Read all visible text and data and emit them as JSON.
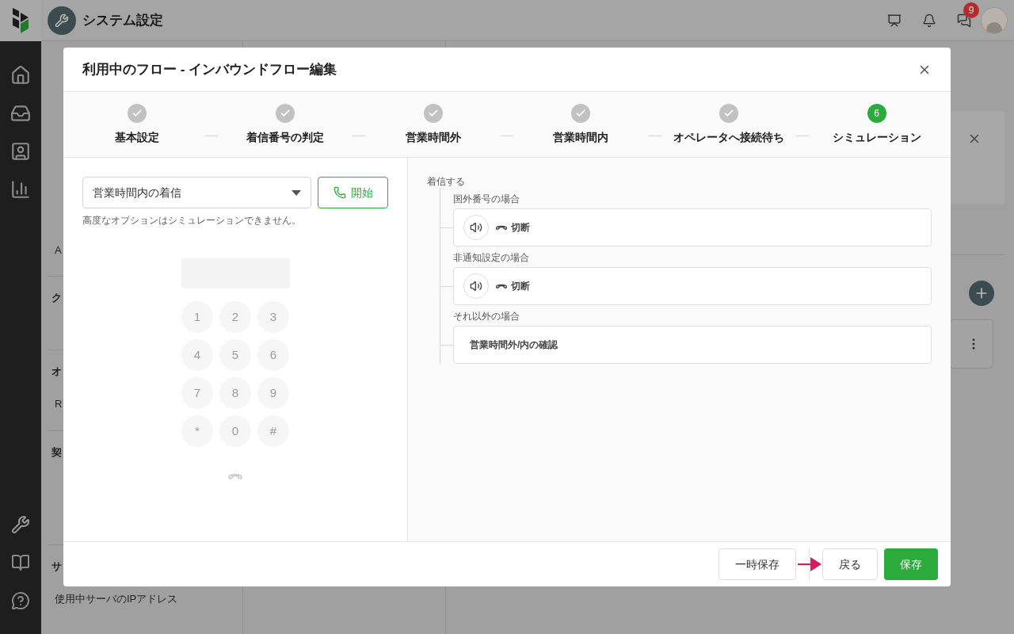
{
  "app_header": {
    "title": "システム設定",
    "notification_badge": "9"
  },
  "sidebar_fragments": [
    {
      "text": "A",
      "kind": "item",
      "selected": false
    },
    {
      "text": "ク",
      "kind": "heading",
      "selected": false
    },
    {
      "text": "オ",
      "kind": "heading",
      "selected": false
    },
    {
      "text": "R",
      "kind": "item",
      "selected": false
    },
    {
      "text": "契",
      "kind": "heading",
      "selected": false
    },
    {
      "text": "サ",
      "kind": "heading",
      "selected": false
    },
    {
      "text": "使用中サーバのIPアドレス",
      "kind": "item",
      "selected": false
    }
  ],
  "modal": {
    "title": "利用中のフロー - インバウンドフロー編集",
    "steps": [
      {
        "label": "基本設定",
        "completed": true
      },
      {
        "label": "着信番号の判定",
        "completed": true
      },
      {
        "label": "営業時間外",
        "completed": true
      },
      {
        "label": "営業時間内",
        "completed": true
      },
      {
        "label": "オペレータへ接続待ち",
        "completed": true
      },
      {
        "label": "シミュレーション",
        "completed": false,
        "number": "6"
      }
    ],
    "simulation": {
      "scenario": "営業時間内の着信",
      "start_button": "開始",
      "note": "高度なオプションはシミュレーションできません。",
      "keypad": [
        "1",
        "2",
        "3",
        "4",
        "5",
        "6",
        "7",
        "8",
        "9",
        "*",
        "0",
        "#"
      ]
    },
    "flow": {
      "root": "着信する",
      "branches": [
        {
          "condition": "国外番号の場合",
          "kind": "action",
          "action": "切断"
        },
        {
          "condition": "非通知設定の場合",
          "kind": "action",
          "action": "切断"
        },
        {
          "condition": "それ以外の場合",
          "kind": "step",
          "label": "営業時間外/内の確認"
        }
      ]
    },
    "footer_buttons": [
      {
        "label": "一時保存",
        "kind": "secondary"
      },
      {
        "label": "戻る",
        "kind": "secondary"
      },
      {
        "label": "保存",
        "kind": "primary"
      }
    ]
  }
}
